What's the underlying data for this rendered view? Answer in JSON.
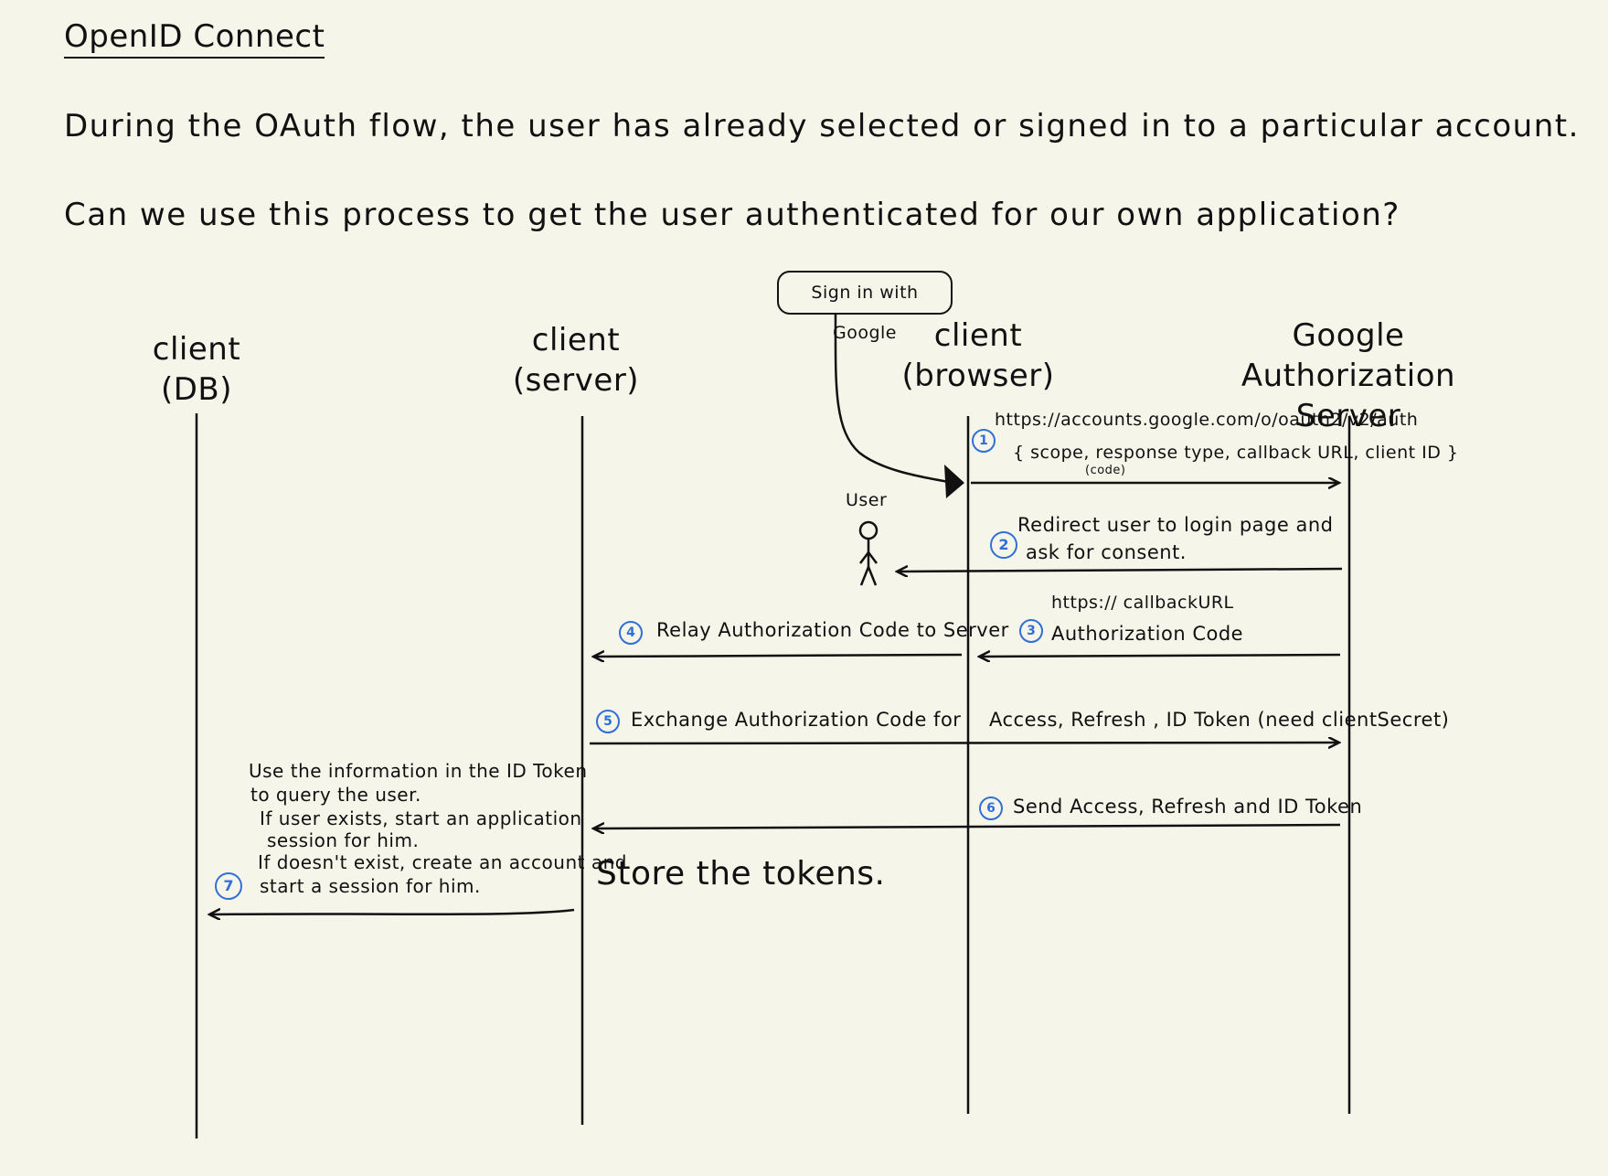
{
  "title": "OpenID Connect",
  "questions": [
    "During the OAuth flow, the user has already selected or signed in to a particular account.",
    "Can we use this process to get the user authenticated for our own application?"
  ],
  "actors": {
    "db": [
      "client",
      "(DB)"
    ],
    "server": [
      "client",
      "(server)"
    ],
    "browser": [
      "client",
      "(browser)"
    ],
    "google": [
      "Google",
      "Authorization Server"
    ]
  },
  "sign_in_button": "Sign in with Google",
  "user_label": "User",
  "steps": [
    {
      "number": "1",
      "lines": [
        "https://accounts.google.com/o/oauth2/v2/auth",
        "{ scope, response type, callback URL, client ID }"
      ],
      "sub": "(code)"
    },
    {
      "number": "2",
      "lines": [
        "Redirect user to login page and",
        "ask for consent."
      ]
    },
    {
      "number": "3",
      "lines": [
        "https:// callbackURL",
        "Authorization Code"
      ]
    },
    {
      "number": "4",
      "lines": [
        "Relay Authorization Code to Server"
      ]
    },
    {
      "number": "5",
      "lines": [
        "Exchange Authorization Code for",
        "Access, Refresh , ID Token (need clientSecret)"
      ]
    },
    {
      "number": "6",
      "lines": [
        "Send Access, Refresh and ID Token"
      ]
    },
    {
      "number": "7",
      "lines": [
        "Use the information in the ID Token",
        "to query the user.",
        "If user exists, start an application",
        "session for him.",
        "If doesn't exist, create an account and",
        "start a session for him."
      ]
    }
  ],
  "store_note": "Store the tokens."
}
